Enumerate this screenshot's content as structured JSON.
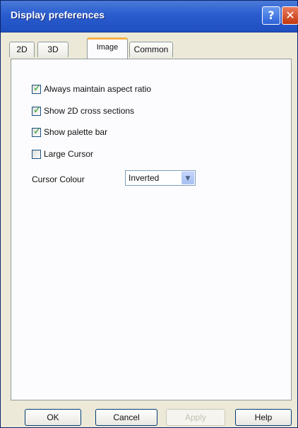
{
  "window": {
    "title": "Display preferences",
    "help_glyph": "?",
    "close_glyph": "✕"
  },
  "tabs": [
    {
      "label": "2D",
      "active": false
    },
    {
      "label": "3D",
      "active": false
    },
    {
      "label": "Image",
      "active": true
    },
    {
      "label": "Common",
      "active": false
    }
  ],
  "options": [
    {
      "label": "Always maintain aspect ratio",
      "checked": true
    },
    {
      "label": "Show 2D cross sections",
      "checked": true
    },
    {
      "label": "Show palette bar",
      "checked": true
    },
    {
      "label": "Large Cursor",
      "checked": false
    }
  ],
  "cursor_colour": {
    "label": "Cursor Colour",
    "selected": "Inverted"
  },
  "buttons": {
    "ok": "OK",
    "cancel": "Cancel",
    "apply": "Apply",
    "help": "Help"
  },
  "colors": {
    "title_bar": "#2a5ccf",
    "check_mark": "#21a121",
    "active_tab_accent": "#f5b24a"
  }
}
